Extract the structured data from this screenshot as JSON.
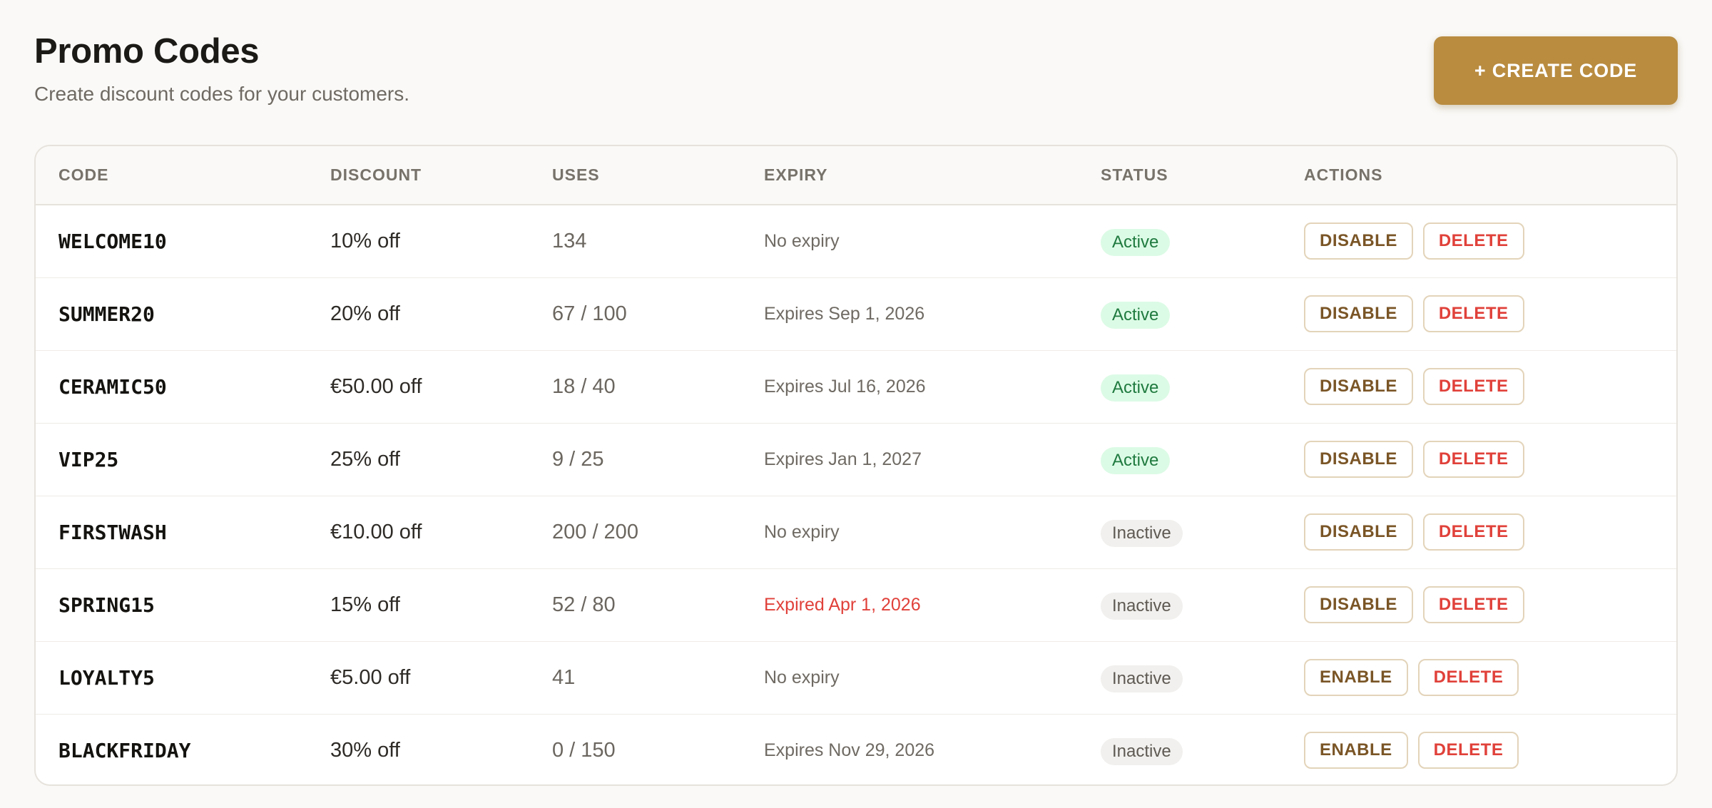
{
  "header": {
    "title": "Promo Codes",
    "subtitle": "Create discount codes for your customers.",
    "create_label": "+ CREATE CODE"
  },
  "table": {
    "columns": [
      "CODE",
      "DISCOUNT",
      "USES",
      "EXPIRY",
      "STATUS",
      "ACTIONS"
    ],
    "rows": [
      {
        "code": "WELCOME10",
        "discount": "10% off",
        "uses": "134",
        "expiry": "No expiry",
        "expired": false,
        "status": "Active",
        "toggle_label": "DISABLE",
        "delete_label": "DELETE"
      },
      {
        "code": "SUMMER20",
        "discount": "20% off",
        "uses": "67 / 100",
        "expiry": "Expires Sep 1, 2026",
        "expired": false,
        "status": "Active",
        "toggle_label": "DISABLE",
        "delete_label": "DELETE"
      },
      {
        "code": "CERAMIC50",
        "discount": "€50.00 off",
        "uses": "18 / 40",
        "expiry": "Expires Jul 16, 2026",
        "expired": false,
        "status": "Active",
        "toggle_label": "DISABLE",
        "delete_label": "DELETE"
      },
      {
        "code": "VIP25",
        "discount": "25% off",
        "uses": "9 / 25",
        "expiry": "Expires Jan 1, 2027",
        "expired": false,
        "status": "Active",
        "toggle_label": "DISABLE",
        "delete_label": "DELETE"
      },
      {
        "code": "FIRSTWASH",
        "discount": "€10.00 off",
        "uses": "200 / 200",
        "expiry": "No expiry",
        "expired": false,
        "status": "Inactive",
        "toggle_label": "DISABLE",
        "delete_label": "DELETE"
      },
      {
        "code": "SPRING15",
        "discount": "15% off",
        "uses": "52 / 80",
        "expiry": "Expired Apr 1, 2026",
        "expired": true,
        "status": "Inactive",
        "toggle_label": "DISABLE",
        "delete_label": "DELETE"
      },
      {
        "code": "LOYALTY5",
        "discount": "€5.00 off",
        "uses": "41",
        "expiry": "No expiry",
        "expired": false,
        "status": "Inactive",
        "toggle_label": "ENABLE",
        "delete_label": "DELETE"
      },
      {
        "code": "BLACKFRIDAY",
        "discount": "30% off",
        "uses": "0 / 150",
        "expiry": "Expires Nov 29, 2026",
        "expired": false,
        "status": "Inactive",
        "toggle_label": "ENABLE",
        "delete_label": "DELETE"
      }
    ]
  },
  "colors": {
    "accent": "#b98c40",
    "active_bg": "#dcfbe6",
    "active_text": "#1f7a3f",
    "inactive_bg": "#f1f0ee",
    "delete_text": "#e0413a",
    "expired_text": "#e0413a"
  }
}
